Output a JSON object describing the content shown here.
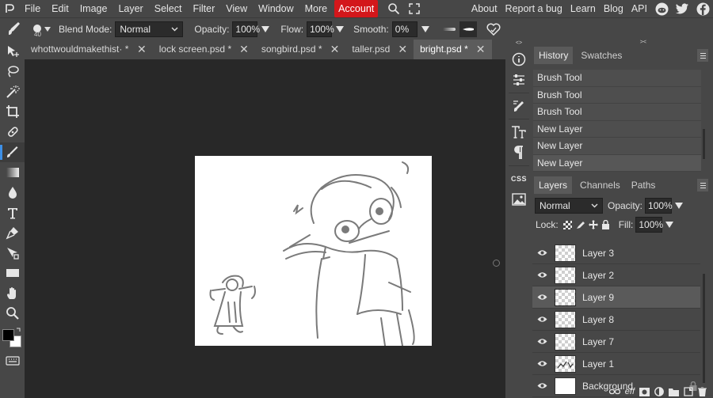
{
  "menu": {
    "items": [
      "File",
      "Edit",
      "Image",
      "Layer",
      "Select",
      "Filter",
      "View",
      "Window",
      "More"
    ],
    "account": "Account",
    "right_links": [
      "About",
      "Report a bug",
      "Learn",
      "Blog",
      "API"
    ]
  },
  "options": {
    "brush_size": "40",
    "blend_mode_label": "Blend Mode:",
    "blend_mode_value": "Normal",
    "opacity_label": "Opacity:",
    "opacity_value": "100%",
    "flow_label": "Flow:",
    "flow_value": "100%",
    "smooth_label": "Smooth:",
    "smooth_value": "0%"
  },
  "tabs": [
    {
      "name": "whottwouldmakethist· *",
      "active": false
    },
    {
      "name": "lock screen.psd *",
      "active": false
    },
    {
      "name": "songbird.psd *",
      "active": false
    },
    {
      "name": "taller.psd",
      "active": false
    },
    {
      "name": "bright.psd *",
      "active": true
    }
  ],
  "midcol": {
    "css_label": "CSS"
  },
  "history_panel": {
    "tabs": [
      "History",
      "Swatches"
    ],
    "items": [
      "Brush Tool",
      "Brush Tool",
      "Brush Tool",
      "New Layer",
      "New Layer",
      "New Layer"
    ]
  },
  "layers_panel": {
    "tabs": [
      "Layers",
      "Channels",
      "Paths"
    ],
    "blend_mode": "Normal",
    "opacity_label": "Opacity:",
    "opacity_value": "100%",
    "lock_label": "Lock:",
    "fill_label": "Fill:",
    "fill_value": "100%",
    "layers": [
      {
        "name": "Layer 3",
        "selected": false
      },
      {
        "name": "Layer 2",
        "selected": false
      },
      {
        "name": "Layer 9",
        "selected": true
      },
      {
        "name": "Layer 8",
        "selected": false
      },
      {
        "name": "Layer 7",
        "selected": false
      },
      {
        "name": "Layer 1",
        "selected": false
      },
      {
        "name": "Background",
        "selected": false
      }
    ],
    "bottom_label": "eff"
  },
  "colors": {
    "accent": "#3d8fe6",
    "account": "#d3171b",
    "panel": "#474747",
    "workspace": "#282828"
  }
}
